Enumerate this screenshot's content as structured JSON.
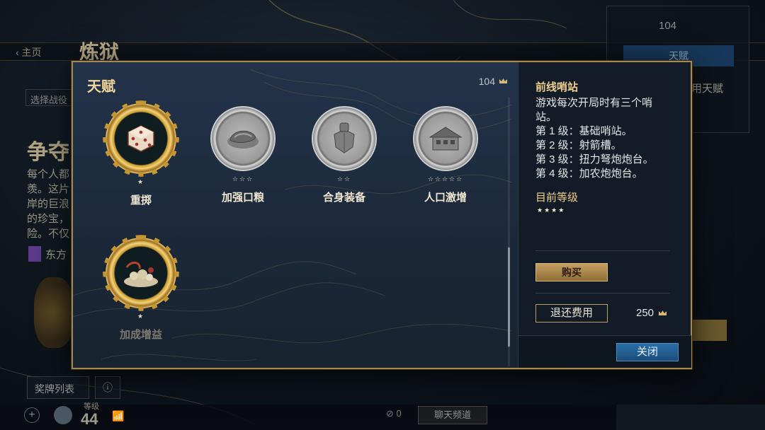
{
  "background": {
    "back_label": "‹ 主页",
    "title": "炼狱",
    "dropdown": "选择战役",
    "heading": "争夺",
    "paragraph": [
      "每个人都",
      "羡。这片",
      "岸的巨浪",
      "的珍宝，",
      "险。不仅"
    ],
    "faction": "东方",
    "medal_list_button": "奖牌列表",
    "info_button": "ⓘ",
    "level_label": "等级",
    "level_value": "44",
    "chat_count": "⊘ 0",
    "chat_button": "聊天频道",
    "right_count": "104",
    "right_tab": "天赋",
    "right_text": "用天赋"
  },
  "modal": {
    "title": "天赋",
    "currency": "104",
    "talents": [
      {
        "name": "重掷",
        "stars": "★",
        "style": "gold",
        "icon": "dice-icon",
        "available": true
      },
      {
        "name": "加强口粮",
        "stars": "☆☆☆",
        "style": "silver",
        "icon": "meat-icon",
        "available": true
      },
      {
        "name": "合身装备",
        "stars": "☆☆",
        "style": "silver",
        "icon": "armor-icon",
        "available": true
      },
      {
        "name": "人口激增",
        "stars": "☆☆☆☆☆",
        "style": "silver",
        "icon": "house-icon",
        "available": true
      },
      {
        "name": "加成增益",
        "stars": "★",
        "style": "gold",
        "icon": "treasure-icon",
        "available": false
      }
    ],
    "detail": {
      "title": "前线哨站",
      "description": [
        "游戏每次开局时有三个哨",
        "站。",
        "第 1 级：基础哨站。",
        "第 2 级：射箭槽。",
        "第 3 级：扭力弩炮炮台。",
        "第 4 级：加农炮炮台。"
      ],
      "current_level_label": "目前等级",
      "current_level_stars": "★★★★",
      "buy_button": "购买",
      "refund_button": "退还费用",
      "refund_cost": "250"
    },
    "close_button": "关闭"
  },
  "colors": {
    "accent_gold": "#f0d08c",
    "frame_gold": "#a48a52",
    "close_blue": "#1b4d7a"
  }
}
